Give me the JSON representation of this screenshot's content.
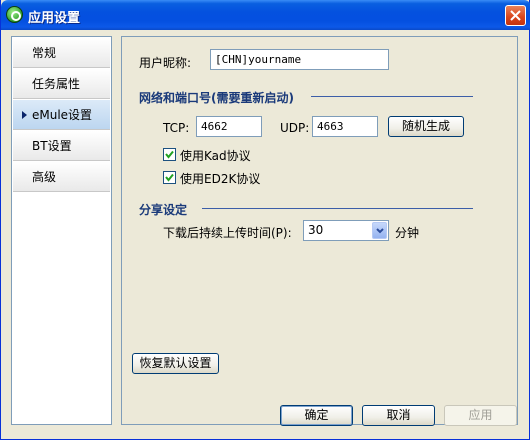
{
  "window": {
    "title": "应用设置"
  },
  "sidebar": {
    "items": [
      {
        "label": "常规"
      },
      {
        "label": "任务属性"
      },
      {
        "label": "eMule设置",
        "active": true
      },
      {
        "label": "BT设置"
      },
      {
        "label": "高级"
      }
    ]
  },
  "panel": {
    "nickname_label": "用户昵称:",
    "nickname_value": "[CHN]yourname",
    "network_section": "网络和端口号(需要重新启动)",
    "tcp_label": "TCP:",
    "tcp_value": "4662",
    "udp_label": "UDP:",
    "udp_value": "4663",
    "random_button": "随机生成",
    "kad_label": "使用Kad协议",
    "kad_checked": true,
    "ed2k_label": "使用ED2K协议",
    "ed2k_checked": true,
    "share_section": "分享设定",
    "upload_time_label": "下载后持续上传时间(P):",
    "upload_time_value": "30",
    "upload_time_unit": "分钟",
    "restore_button": "恢复默认设置"
  },
  "footer": {
    "ok_button": "确定",
    "cancel_button": "取消",
    "apply_button": "应用"
  },
  "colors": {
    "titlebar": "#0451df",
    "section_title": "#1a3a7a",
    "panel_bg": "#ece9d8"
  }
}
